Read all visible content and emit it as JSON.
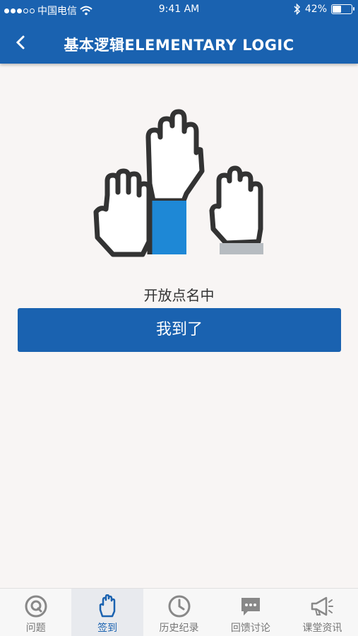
{
  "status_bar": {
    "carrier": "中国电信",
    "time": "9:41 AM",
    "battery": "42%",
    "battery_level": 0.42
  },
  "header": {
    "title": "基本逻辑ELEMENTARY LOGIC",
    "back_icon": "chevron-left-icon"
  },
  "main": {
    "illustration": "raised-hands-icon",
    "status_text": "开放点名中",
    "checkin_button": "我到了"
  },
  "tabs": [
    {
      "label": "问题",
      "icon": "question-circle-icon",
      "active": false
    },
    {
      "label": "签到",
      "icon": "hand-icon",
      "active": true
    },
    {
      "label": "历史纪录",
      "icon": "clock-icon",
      "active": false
    },
    {
      "label": "回馈讨论",
      "icon": "chat-bubble-icon",
      "active": false
    },
    {
      "label": "课堂资讯",
      "icon": "megaphone-icon",
      "active": false
    }
  ],
  "colors": {
    "primary": "#1a62b0",
    "sleeve_blue": "#1e88d6",
    "sleeve_gray": "#b7bcc1",
    "outline": "#333333",
    "background": "#f8f5f4"
  }
}
